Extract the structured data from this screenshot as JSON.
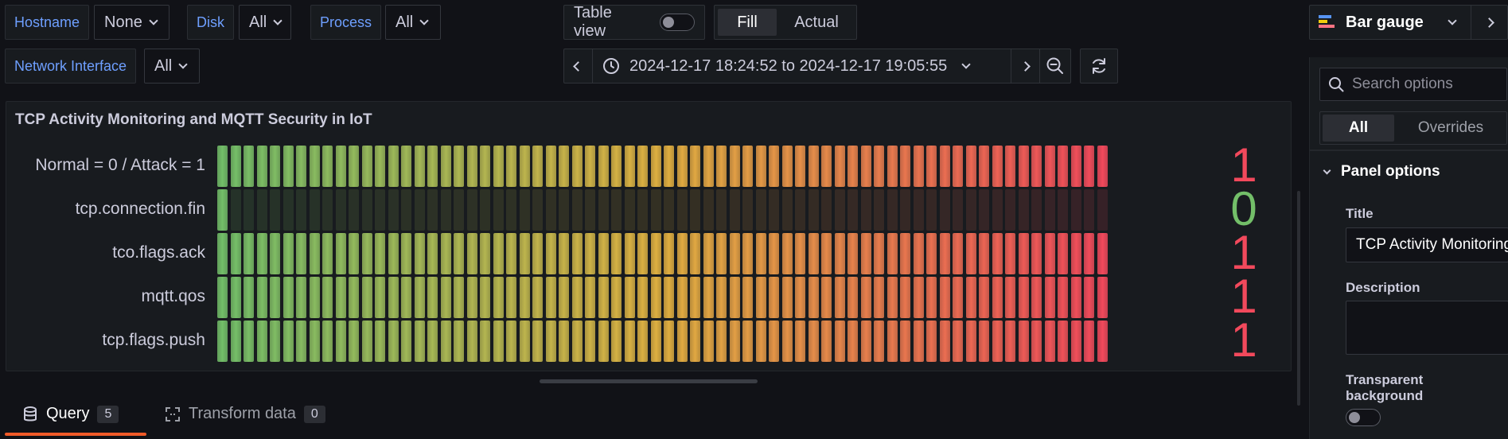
{
  "variables": [
    {
      "label": "Hostname",
      "value": "None"
    },
    {
      "label": "Disk",
      "value": "All"
    },
    {
      "label": "Process",
      "value": "All"
    },
    {
      "label": "Network Interface",
      "value": "All"
    }
  ],
  "view_controls": {
    "table_view_label": "Table view",
    "table_view_on": false,
    "fill_label": "Fill",
    "actual_label": "Actual",
    "selected": "Fill"
  },
  "time_range": {
    "text": "2024-12-17 18:24:52 to 2024-12-17 19:05:55"
  },
  "visualization": {
    "name": "Bar gauge"
  },
  "panel": {
    "title": "TCP Activity Monitoring and MQTT Security in IoT",
    "rows": [
      {
        "label": "Normal = 0 / Attack = 1",
        "value": "1",
        "fraction": 1
      },
      {
        "label": "tcp.connection.fin",
        "value": "0",
        "fraction": 0
      },
      {
        "label": "tco.flags.ack",
        "value": "1",
        "fraction": 1
      },
      {
        "label": "mqtt.qos",
        "value": "1",
        "fraction": 1
      },
      {
        "label": "tcp.flags.push",
        "value": "1",
        "fraction": 1
      }
    ],
    "colors": {
      "low": "#73bf69",
      "mid": "#e0b040",
      "high": "#f2495c"
    }
  },
  "editor_tabs": [
    {
      "label": "Query",
      "count": "5",
      "active": true
    },
    {
      "label": "Transform data",
      "count": "0",
      "active": false
    }
  ],
  "options_pane": {
    "search_placeholder": "Search options",
    "tabs": [
      "All",
      "Overrides"
    ],
    "active_tab": "All",
    "section": "Panel options",
    "title_label": "Title",
    "title_value": "TCP Activity Monitoring and MQTT Security in IoT",
    "description_label": "Description",
    "description_value": "",
    "transparent_label": "Transparent background",
    "transparent_on": false
  }
}
